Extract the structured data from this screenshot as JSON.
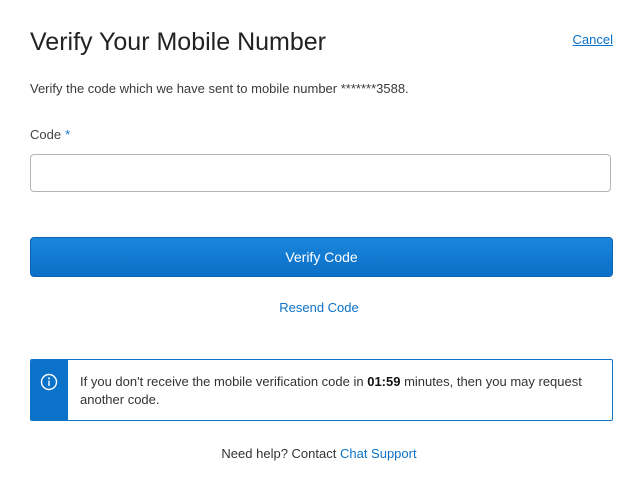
{
  "header": {
    "title": "Verify Your Mobile Number",
    "cancel_label": "Cancel"
  },
  "instruction": "Verify the code which we have sent to mobile number *******3588.",
  "code_field": {
    "label": "Code",
    "required_marker": "*",
    "value": "",
    "placeholder": ""
  },
  "verify_button_label": "Verify Code",
  "resend_label": "Resend Code",
  "info": {
    "icon": "info-circle-icon",
    "text_before": "If you don't receive the mobile verification code in",
    "countdown": "01:59",
    "text_after": "minutes, then you may request another code."
  },
  "help": {
    "prefix": "Need help? Contact",
    "link_label": "Chat Support"
  },
  "colors": {
    "accent": "#0b72c9",
    "button": "#1a86dc",
    "text": "#333333"
  }
}
